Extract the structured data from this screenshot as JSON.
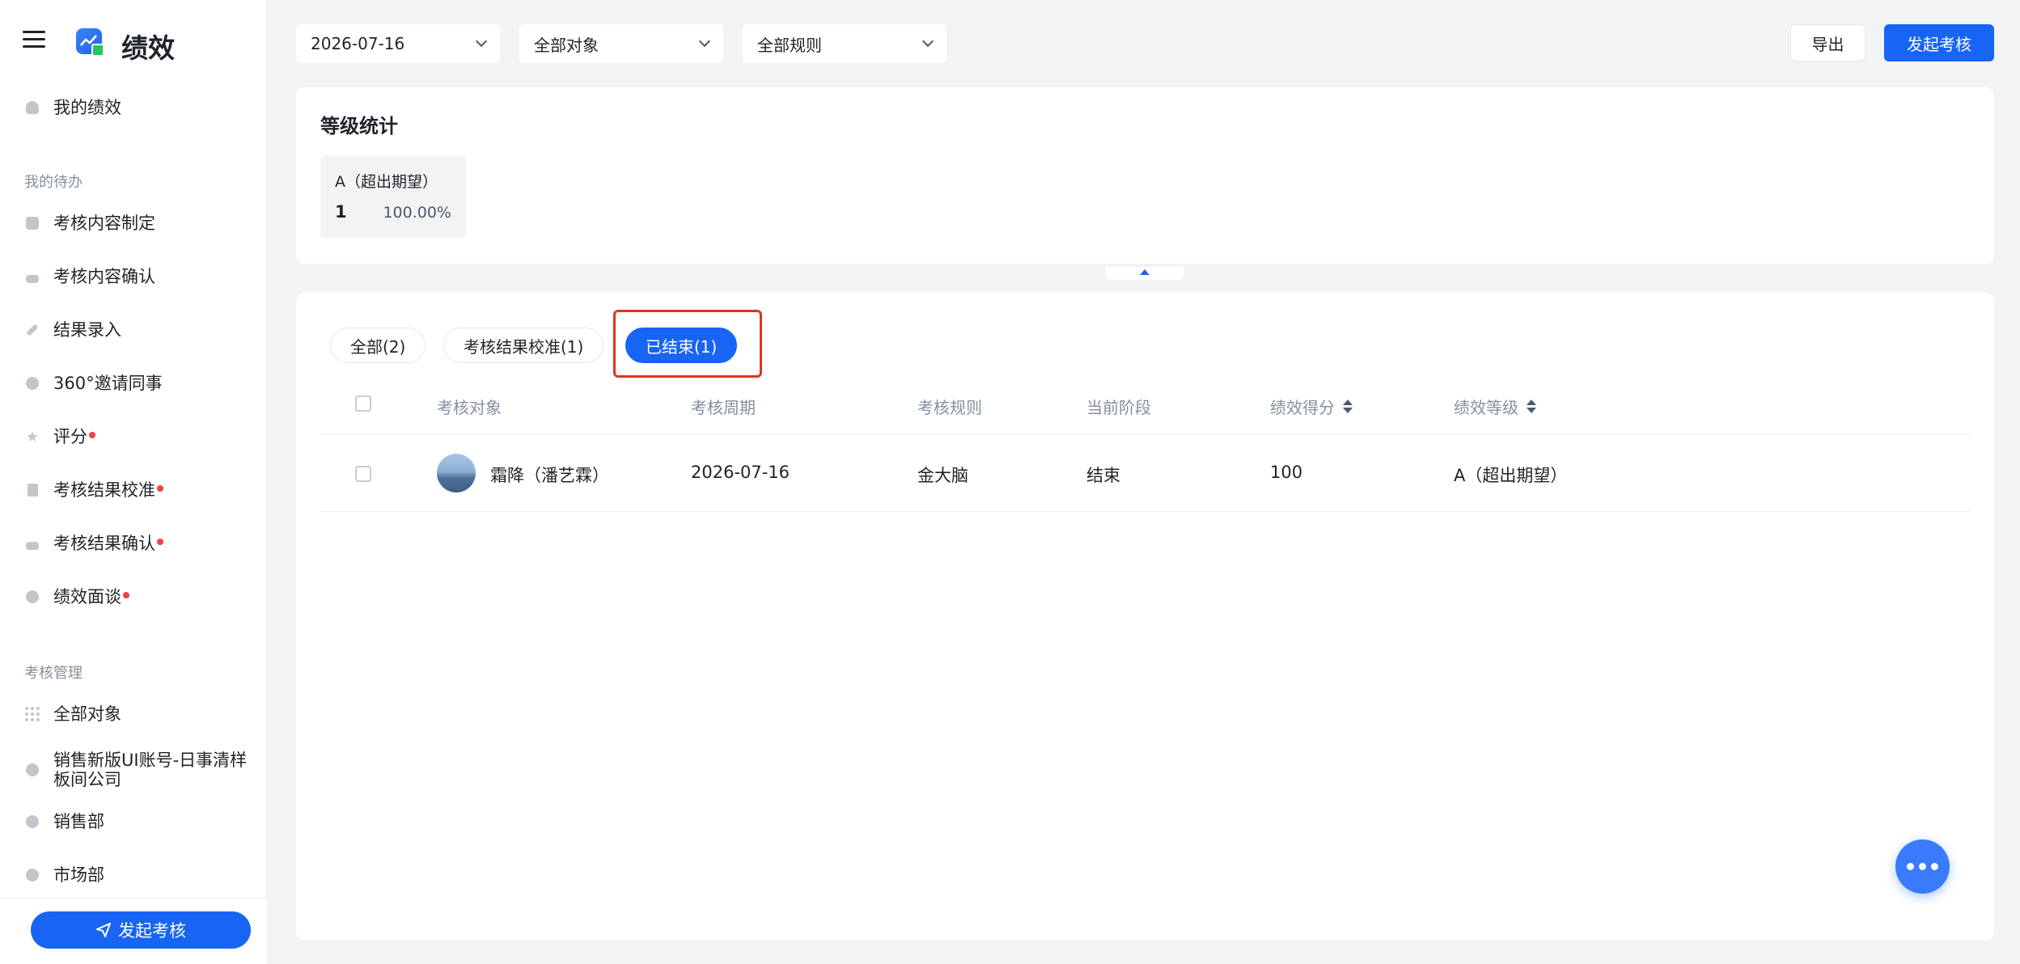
{
  "app": {
    "title": "绩效"
  },
  "sidebar": {
    "my_performance": "我的绩效",
    "todo_section": "我的待办",
    "todo_items": [
      {
        "label": "考核内容制定",
        "dot": false,
        "icon": "clipboard-icon"
      },
      {
        "label": "考核内容确认",
        "dot": false,
        "icon": "stamp-icon"
      },
      {
        "label": "结果录入",
        "dot": false,
        "icon": "pen-icon"
      },
      {
        "label": "360°邀请同事",
        "dot": false,
        "icon": "360-icon"
      },
      {
        "label": "评分",
        "dot": true,
        "icon": "star-icon"
      },
      {
        "label": "考核结果校准",
        "dot": true,
        "icon": "bookmark-icon"
      },
      {
        "label": "考核结果确认",
        "dot": true,
        "icon": "stamp-icon"
      },
      {
        "label": "绩效面谈",
        "dot": true,
        "icon": "chat-icon"
      }
    ],
    "manage_section": "考核管理",
    "manage_items": [
      {
        "label": "全部对象",
        "icon": "grid-icon"
      },
      {
        "label": "销售新版UI账号-日事清样板间公司",
        "icon": "badge-icon"
      },
      {
        "label": "销售部",
        "icon": "badge-icon"
      },
      {
        "label": "市场部",
        "icon": "badge-icon"
      }
    ],
    "launch_button": "发起考核"
  },
  "filters": {
    "date": "2026-07-16",
    "target": "全部对象",
    "rule": "全部规则"
  },
  "toolbar": {
    "export_label": "导出",
    "launch_label": "发起考核"
  },
  "stats": {
    "title": "等级统计",
    "grades": [
      {
        "name": "A（超出期望）",
        "count": "1",
        "percent": "100.00%"
      }
    ]
  },
  "tabs": [
    {
      "label": "全部(2)",
      "active": false
    },
    {
      "label": "考核结果校准(1)",
      "active": false
    },
    {
      "label": "已结束(1)",
      "active": true
    }
  ],
  "table": {
    "columns": [
      "考核对象",
      "考核周期",
      "考核规则",
      "当前阶段",
      "绩效得分",
      "绩效等级"
    ],
    "rows": [
      {
        "name": "霜降（潘艺霖）",
        "period": "2026-07-16",
        "rule": "金大脑",
        "stage": "结束",
        "score": "100",
        "grade": "A（超出期望）"
      }
    ]
  },
  "colors": {
    "primary": "#1764f5",
    "alert_dot": "#f53f3f",
    "highlight_border": "#e0341e"
  }
}
